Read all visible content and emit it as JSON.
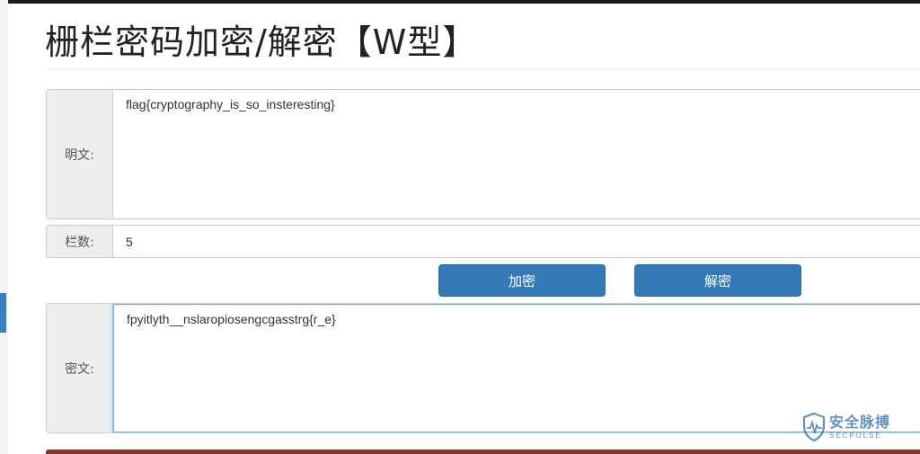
{
  "page": {
    "title": "栅栏密码加密/解密【W型】"
  },
  "form": {
    "plaintext_label": "明文:",
    "plaintext_value": "flag{cryptography_is_so_insteresting}",
    "rails_label": "栏数:",
    "rails_value": "5",
    "ciphertext_label": "密文:",
    "ciphertext_value": "fpyitlyth__nslaropiosengcgasstrg{r_e}"
  },
  "buttons": {
    "encrypt_label": "加密",
    "decrypt_label": "解密"
  },
  "watermark": {
    "name": "安全脉搏",
    "subtitle": "SECPULSE",
    "icon": "shield-pulse-icon"
  },
  "colors": {
    "primary": "#337ab7",
    "addon_bg": "#eeeeee",
    "focus_border": "#66afe9"
  }
}
